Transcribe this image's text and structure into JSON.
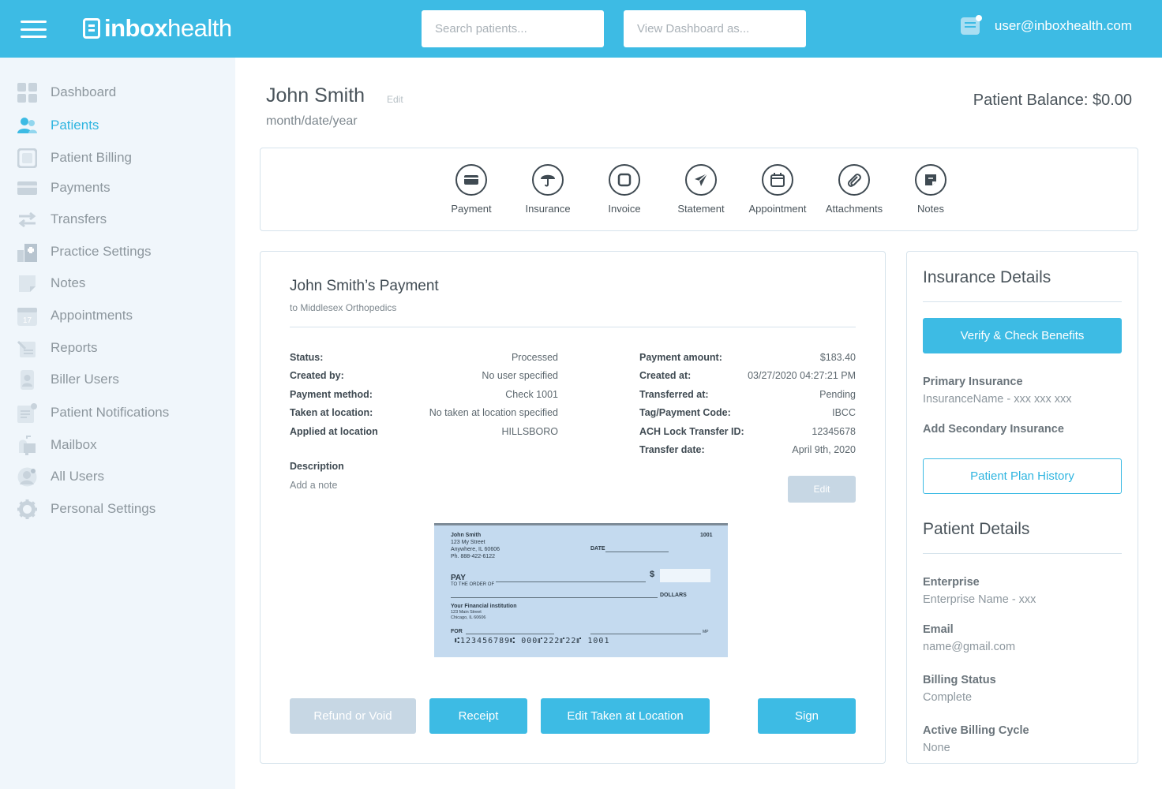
{
  "header": {
    "logo_brand": "inbox",
    "logo_rest": "health",
    "search_placeholder": "Search patients...",
    "dashboard_placeholder": "View Dashboard as...",
    "user_email": "user@inboxhealth.com",
    "brand_color": "#3dbbe4"
  },
  "sidebar": {
    "items": [
      {
        "label": "Dashboard",
        "icon": "dashboard-grid-icon"
      },
      {
        "label": "Patients",
        "icon": "patients-icon",
        "active": true
      },
      {
        "label": "Patient Billing",
        "icon": "patient-billing-icon"
      },
      {
        "label": "Payments",
        "icon": "credit-card-icon"
      },
      {
        "label": "Transfers",
        "icon": "transfer-arrows-icon"
      },
      {
        "label": "Practice Settings",
        "icon": "building-icon"
      },
      {
        "label": "Notes",
        "icon": "note-icon"
      },
      {
        "label": "Appointments",
        "icon": "calendar-icon",
        "icon_text": "17"
      },
      {
        "label": "Reports",
        "icon": "reports-icon"
      },
      {
        "label": "Biller Users",
        "icon": "biller-user-icon"
      },
      {
        "label": "Patient Notifications",
        "icon": "notification-icon"
      },
      {
        "label": "Mailbox",
        "icon": "mailbox-icon"
      },
      {
        "label": "All Users",
        "icon": "all-users-icon"
      },
      {
        "label": "Personal Settings",
        "icon": "gear-icon"
      }
    ]
  },
  "patient": {
    "name": "John Smith",
    "edit_label": "Edit",
    "dob": "month/date/year",
    "balance_label": "Patient Balance: $0.00"
  },
  "actions": [
    {
      "label": "Payment",
      "icon": "payment-card-icon"
    },
    {
      "label": "Insurance",
      "icon": "umbrella-icon"
    },
    {
      "label": "Invoice",
      "icon": "invoice-icon"
    },
    {
      "label": "Statement",
      "icon": "paper-plane-icon"
    },
    {
      "label": "Appointment",
      "icon": "calendar-icon"
    },
    {
      "label": "Attachments",
      "icon": "paperclip-icon"
    },
    {
      "label": "Notes",
      "icon": "note-icon"
    }
  ],
  "payment": {
    "title": "John Smith’s Payment",
    "subtitle": "to Middlesex Orthopedics",
    "left_fields": [
      {
        "key": "Status:",
        "value": "Processed"
      },
      {
        "key": "Created by:",
        "value": "No user specified"
      },
      {
        "key": "Payment method:",
        "value": "Check 1001"
      },
      {
        "key": "Taken at location:",
        "value": "No taken at location specified"
      },
      {
        "key": "Applied at location",
        "value": "HILLSBORO"
      }
    ],
    "right_fields": [
      {
        "key": "Payment amount:",
        "value": "$183.40"
      },
      {
        "key": "Created at:",
        "value": "03/27/2020 04:27:21 PM"
      },
      {
        "key": "Transferred at:",
        "value": "Pending"
      },
      {
        "key": "Tag/Payment Code:",
        "value": "IBCC"
      },
      {
        "key": "ACH Lock Transfer ID:",
        "value": "12345678"
      },
      {
        "key": "Transfer date:",
        "value": "April 9th, 2020"
      }
    ],
    "description_label": "Description",
    "description_note": "Add a note",
    "edit_button": "Edit",
    "buttons": {
      "refund": "Refund or Void",
      "receipt": "Receipt",
      "edit_location": "Edit Taken at Location",
      "sign": "Sign"
    },
    "check": {
      "name": "John Smith",
      "address1": "123 My Street",
      "address2": "Anywhere, IL 60606",
      "phone": "Ph. 888-422-6122",
      "number": "1001",
      "date_label": "DATE",
      "pay_label": "PAY",
      "order_label": "TO THE ORDER OF",
      "dollar_sign": "$",
      "dollars_label": "DOLLARS",
      "bank_name": "Your Financial institution",
      "bank_address1": "123 Main Street",
      "bank_address2": "Chicago, IL 60606",
      "for_label": "FOR",
      "mp_label": "MP",
      "micr": "⑆123456789⑆  000⑈222⑈22⑈  1001"
    }
  },
  "insurance": {
    "title": "Insurance Details",
    "verify_button": "Verify & Check Benefits",
    "primary_label": "Primary Insurance",
    "primary_value": "InsuranceName - xxx xxx xxx",
    "secondary_label": "Add Secondary Insurance",
    "plan_history_button": "Patient Plan History"
  },
  "patient_details": {
    "title": "Patient Details",
    "fields": [
      {
        "label": "Enterprise",
        "value": "Enterprise Name - xxx"
      },
      {
        "label": "Email",
        "value": "name@gmail.com"
      },
      {
        "label": "Billing Status",
        "value": "Complete"
      },
      {
        "label": "Active Billing Cycle",
        "value": "None"
      }
    ]
  }
}
